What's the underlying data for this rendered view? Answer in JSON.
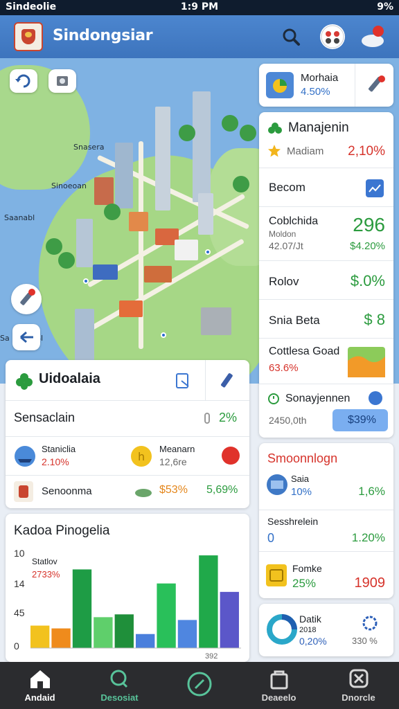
{
  "status_bar": {
    "left": "Sindeolie",
    "time": "1:9 PM",
    "battery": "9%"
  },
  "header": {
    "title": "Sindongsiar"
  },
  "map": {
    "labels": [
      "Snasera",
      "Sinoeoan",
      "Saanabl",
      "Sa",
      "Sl"
    ]
  },
  "right_panel": {
    "top_card": {
      "title": "Morhaia",
      "value": "4.50%"
    },
    "header": "Manajenin",
    "rows": [
      {
        "label": "Madiam",
        "value": "2,10%"
      },
      {
        "label": "Becom"
      },
      {
        "label": "Coblchida",
        "sub1": "Moldon",
        "sub2": "42.07/Jt",
        "value": "296",
        "value2": "$4.20%"
      },
      {
        "label": "Rolov",
        "value": "$.0%"
      },
      {
        "label": "Snia Beta",
        "value": "$ 8"
      },
      {
        "label": "Cottlesa Goad",
        "value": "63.6%"
      },
      {
        "label": "Sonayjennen",
        "sub": "2450,0th",
        "value": "$39%"
      }
    ]
  },
  "left_card": {
    "title": "Uidoalaia",
    "row1": {
      "label": "Sensaclain",
      "value": "2%"
    },
    "row2a": {
      "label": "Staniclia",
      "value": "2.10%"
    },
    "row2b": {
      "label": "Meanarn",
      "value": "12,6re"
    },
    "row3": {
      "label": "Senoonma",
      "value1": "$53%",
      "value2": "5,69%"
    }
  },
  "smoonnlogn": {
    "title": "Smoonnlogn",
    "rows": [
      {
        "label": "Saia",
        "sub": "10%",
        "value": "1,6%"
      },
      {
        "label": "Sesshrelein",
        "sub": "0",
        "value": "1.20%"
      },
      {
        "label": "Fomke",
        "sub": "25%",
        "value": "1909"
      }
    ]
  },
  "donut_card": {
    "title": "Datik",
    "sub": "2018",
    "value": "0,20%",
    "value2": "330 %"
  },
  "chart_card": {
    "title": "Kadoa Pinogelia",
    "annotation_label": "Statlov",
    "annotation_value": "2733%",
    "corner_value": "392"
  },
  "chart_data": {
    "type": "bar",
    "title": "Kadoa Pinogelia",
    "yticks": [
      "10",
      "14",
      "45",
      "0"
    ],
    "series": [
      {
        "values": [
          8,
          0,
          0,
          0,
          0,
          0,
          0,
          0,
          0,
          0
        ]
      },
      {
        "values": [
          0,
          7,
          0,
          0,
          0,
          0,
          0,
          0,
          0,
          0
        ]
      },
      {
        "values": [
          0,
          0,
          28,
          0,
          0,
          0,
          0,
          0,
          0,
          0
        ]
      },
      {
        "values": [
          0,
          0,
          0,
          11,
          0,
          0,
          0,
          0,
          0,
          0
        ]
      },
      {
        "values": [
          0,
          0,
          0,
          12,
          0,
          0,
          0,
          0,
          0,
          0
        ]
      },
      {
        "values": [
          0,
          0,
          0,
          0,
          5,
          0,
          0,
          0,
          0,
          0
        ]
      },
      {
        "values": [
          0,
          0,
          0,
          0,
          0,
          23,
          0,
          0,
          0,
          0
        ]
      },
      {
        "values": [
          0,
          0,
          0,
          0,
          0,
          0,
          10,
          0,
          0,
          0
        ]
      },
      {
        "values": [
          0,
          0,
          0,
          0,
          0,
          0,
          0,
          33,
          0,
          0
        ]
      },
      {
        "values": [
          0,
          0,
          0,
          0,
          0,
          0,
          0,
          0,
          20,
          0
        ]
      }
    ],
    "colors": [
      "#f2c21e",
      "#ef8b1c",
      "#1e9c45",
      "#5fcf6b",
      "#1f8f3a",
      "#4a7fdc",
      "#29c05a",
      "#4f86e0",
      "#20a94a",
      "#5b57c9"
    ]
  },
  "bottom_nav": [
    {
      "label": "Andaid",
      "active": true
    },
    {
      "label": "Desosiat"
    },
    {
      "label": ""
    },
    {
      "label": "Deaeelo"
    },
    {
      "label": "Dnorcle"
    }
  ],
  "colors": {
    "header": "#4179c4",
    "accent_green": "#2b9b3e",
    "accent_red": "#d6332b",
    "nav": "#2b2c2f"
  }
}
